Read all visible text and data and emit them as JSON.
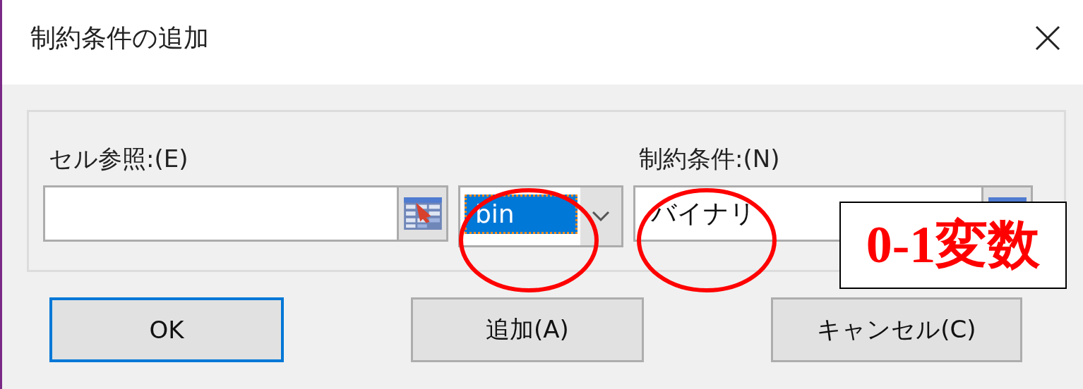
{
  "window": {
    "title": "制約条件の追加"
  },
  "cell_reference": {
    "label": "セル参照:(E)"
  },
  "operator": {
    "value": "bin",
    "highlighted": true
  },
  "constraint": {
    "label": "制約条件:(N)",
    "value": "バイナリ"
  },
  "buttons": [
    {
      "label": "OK",
      "default": true
    },
    {
      "label": "追加(A)",
      "default": false
    },
    {
      "label": "キャンセル(C)",
      "default": false
    }
  ],
  "callout": {
    "text": "0-1変数"
  }
}
